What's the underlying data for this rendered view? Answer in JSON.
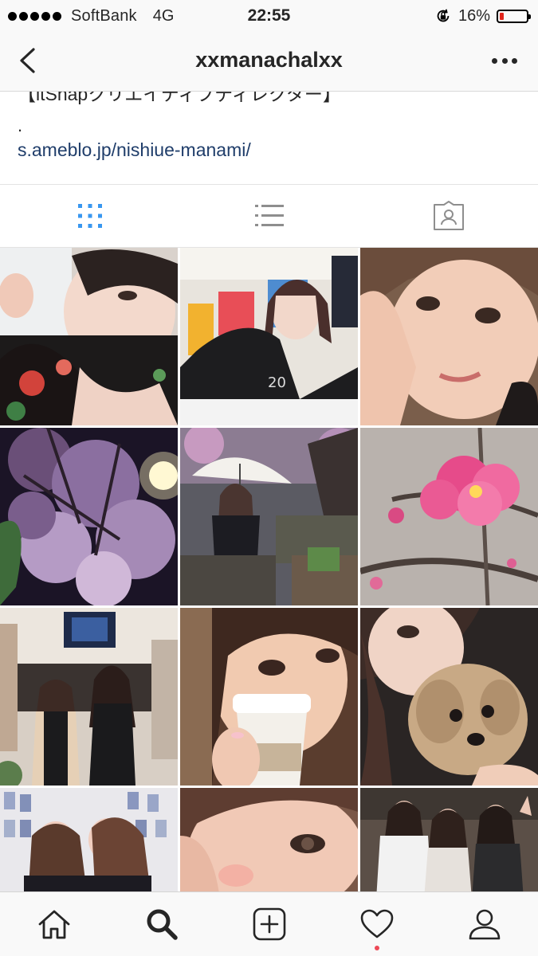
{
  "status_bar": {
    "carrier": "SoftBank",
    "network": "4G",
    "time": "22:55",
    "battery_percent": "16%",
    "battery_level": 0.16,
    "battery_color": "#e0241b"
  },
  "header": {
    "title": "xxmanachalxx",
    "back_icon": "chevron-left-icon",
    "more_icon": "more-dots-icon"
  },
  "bio": {
    "cut_line": "【itSnapクリエイティブディレクター】",
    "dot_line": ".",
    "link": "s.ameblo.jp/nishiue-manami/",
    "link_color": "#1f3d6a"
  },
  "view_tabs": [
    {
      "name": "grid-view",
      "icon": "grid-icon",
      "active": true,
      "color": "#3897f0"
    },
    {
      "name": "list-view",
      "icon": "list-icon",
      "active": false
    },
    {
      "name": "tagged-view",
      "icon": "tagged-person-icon",
      "active": false
    }
  ],
  "photos": [
    {
      "name": "selfie-floral-top"
    },
    {
      "name": "selfie-gallery-paintings"
    },
    {
      "name": "closeup-hand-on-cheek"
    },
    {
      "name": "night-cherry-blossoms"
    },
    {
      "name": "umbrella-under-blossoms"
    },
    {
      "name": "pink-plum-blossom"
    },
    {
      "name": "two-women-in-salon"
    },
    {
      "name": "drinking-coffee-cup"
    },
    {
      "name": "holding-puppy"
    },
    {
      "name": "cheek-kiss-photo-wall"
    },
    {
      "name": "closeup-eye-portrait"
    },
    {
      "name": "three-friends-cafe"
    }
  ],
  "bottom_tabs": [
    {
      "name": "home",
      "icon": "home-icon"
    },
    {
      "name": "search",
      "icon": "search-icon",
      "active": true
    },
    {
      "name": "new-post",
      "icon": "plus-square-icon"
    },
    {
      "name": "activity",
      "icon": "heart-icon",
      "has_notification": true
    },
    {
      "name": "profile",
      "icon": "profile-icon"
    }
  ]
}
